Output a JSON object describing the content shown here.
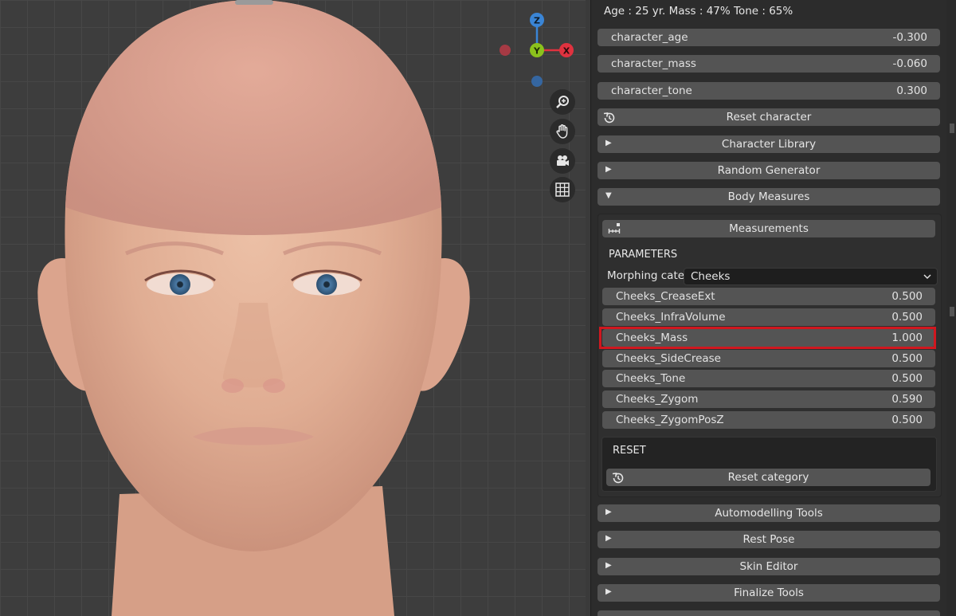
{
  "stats": {
    "text": "Age : 25 yr.  Mass : 47%  Tone : 65%"
  },
  "sliders": [
    {
      "label": "character_age",
      "value": "-0.300"
    },
    {
      "label": "character_mass",
      "value": "-0.060"
    },
    {
      "label": "character_tone",
      "value": "0.300"
    }
  ],
  "buttons": {
    "reset_character": "Reset character",
    "character_library": "Character Library",
    "random_generator": "Random Generator",
    "body_measures": "Body Measures",
    "measurements": "Measurements",
    "reset_category": "Reset category",
    "automodelling_tools": "Automodelling Tools",
    "rest_pose": "Rest Pose",
    "skin_editor": "Skin Editor",
    "finalize_tools": "Finalize Tools"
  },
  "parameters": {
    "heading": "PARAMETERS",
    "category_label": "Morphing cate..",
    "category_value": "Cheeks",
    "morphs": [
      {
        "label": "Cheeks_CreaseExt",
        "value": "0.500"
      },
      {
        "label": "Cheeks_InfraVolume",
        "value": "0.500"
      },
      {
        "label": "Cheeks_Mass",
        "value": "1.000"
      },
      {
        "label": "Cheeks_SideCrease",
        "value": "0.500"
      },
      {
        "label": "Cheeks_Tone",
        "value": "0.500"
      },
      {
        "label": "Cheeks_Zygom",
        "value": "0.590"
      },
      {
        "label": "Cheeks_ZygomPosZ",
        "value": "0.500"
      }
    ],
    "highlighted_item": "Cheeks_Mass"
  },
  "reset": {
    "heading": "RESET"
  },
  "gizmo": {
    "z": "Z",
    "y": "Y",
    "x": "X"
  },
  "colors": {
    "highlight": "#d0171f",
    "axis_x": "#e0323f",
    "axis_y": "#8bc21c",
    "axis_z": "#3a85d6"
  },
  "icons": [
    "zoom-icon",
    "hand-pan-icon",
    "camera-icon",
    "grid-icon",
    "reset-history-icon",
    "ruler-icon",
    "disclosure-triangle-icon",
    "chevron-down-icon"
  ]
}
